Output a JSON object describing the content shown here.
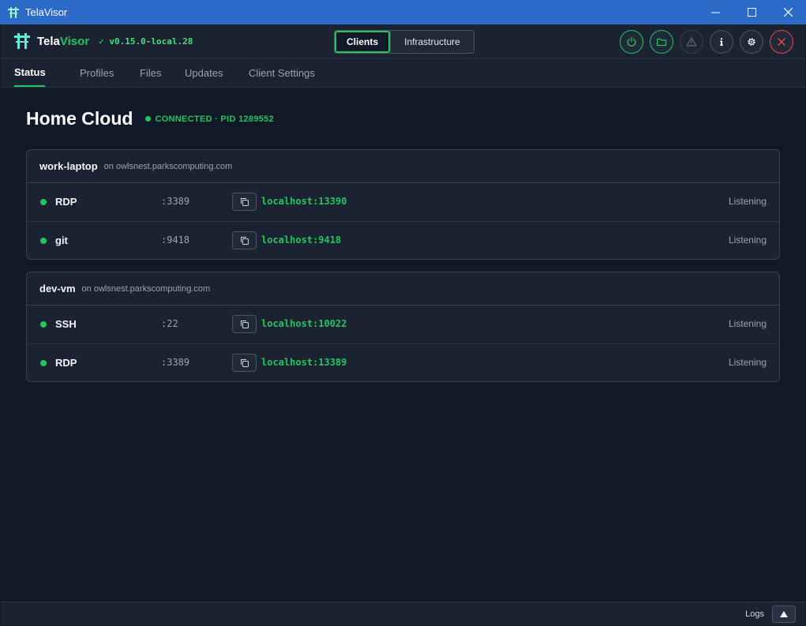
{
  "window": {
    "title": "TelaVisor",
    "icon": "tela-app-icon",
    "controls": [
      "minimize-icon",
      "maximize-icon",
      "close-icon"
    ]
  },
  "header": {
    "brand_primary": "Tela",
    "brand_accent": "Visor",
    "version": "✓ v0.15.0-local.28",
    "modes": {
      "active": "Clients",
      "inactive": "Infrastructure"
    },
    "actions": [
      "power-icon",
      "folder-icon",
      "warning-icon",
      "info-icon",
      "gear-icon",
      "close-icon"
    ]
  },
  "tabs": [
    "Status",
    "Profiles",
    "Files",
    "Updates",
    "Client Settings"
  ],
  "active_tab": "Status",
  "page": {
    "title": "Home Cloud",
    "status": "CONNECTED · PID 1289552"
  },
  "machines": [
    {
      "name": "work-laptop",
      "host": "on owlsnest.parkscomputing.com",
      "services": [
        {
          "name": "RDP",
          "port": ":3389",
          "local": "localhost:13390",
          "state": "Listening"
        },
        {
          "name": "git",
          "port": ":9418",
          "local": "localhost:9418",
          "state": "Listening"
        }
      ]
    },
    {
      "name": "dev-vm",
      "host": "on owlsnest.parkscomputing.com",
      "services": [
        {
          "name": "SSH",
          "port": ":22",
          "local": "localhost:10022",
          "state": "Listening"
        },
        {
          "name": "RDP",
          "port": ":3389",
          "local": "localhost:13389",
          "state": "Listening"
        }
      ]
    }
  ],
  "footer": {
    "logs_label": "Logs"
  },
  "colors": {
    "accent": "#22c55e",
    "titlebar": "#2d6bc9",
    "background": "#111827",
    "danger": "#ef4444"
  }
}
